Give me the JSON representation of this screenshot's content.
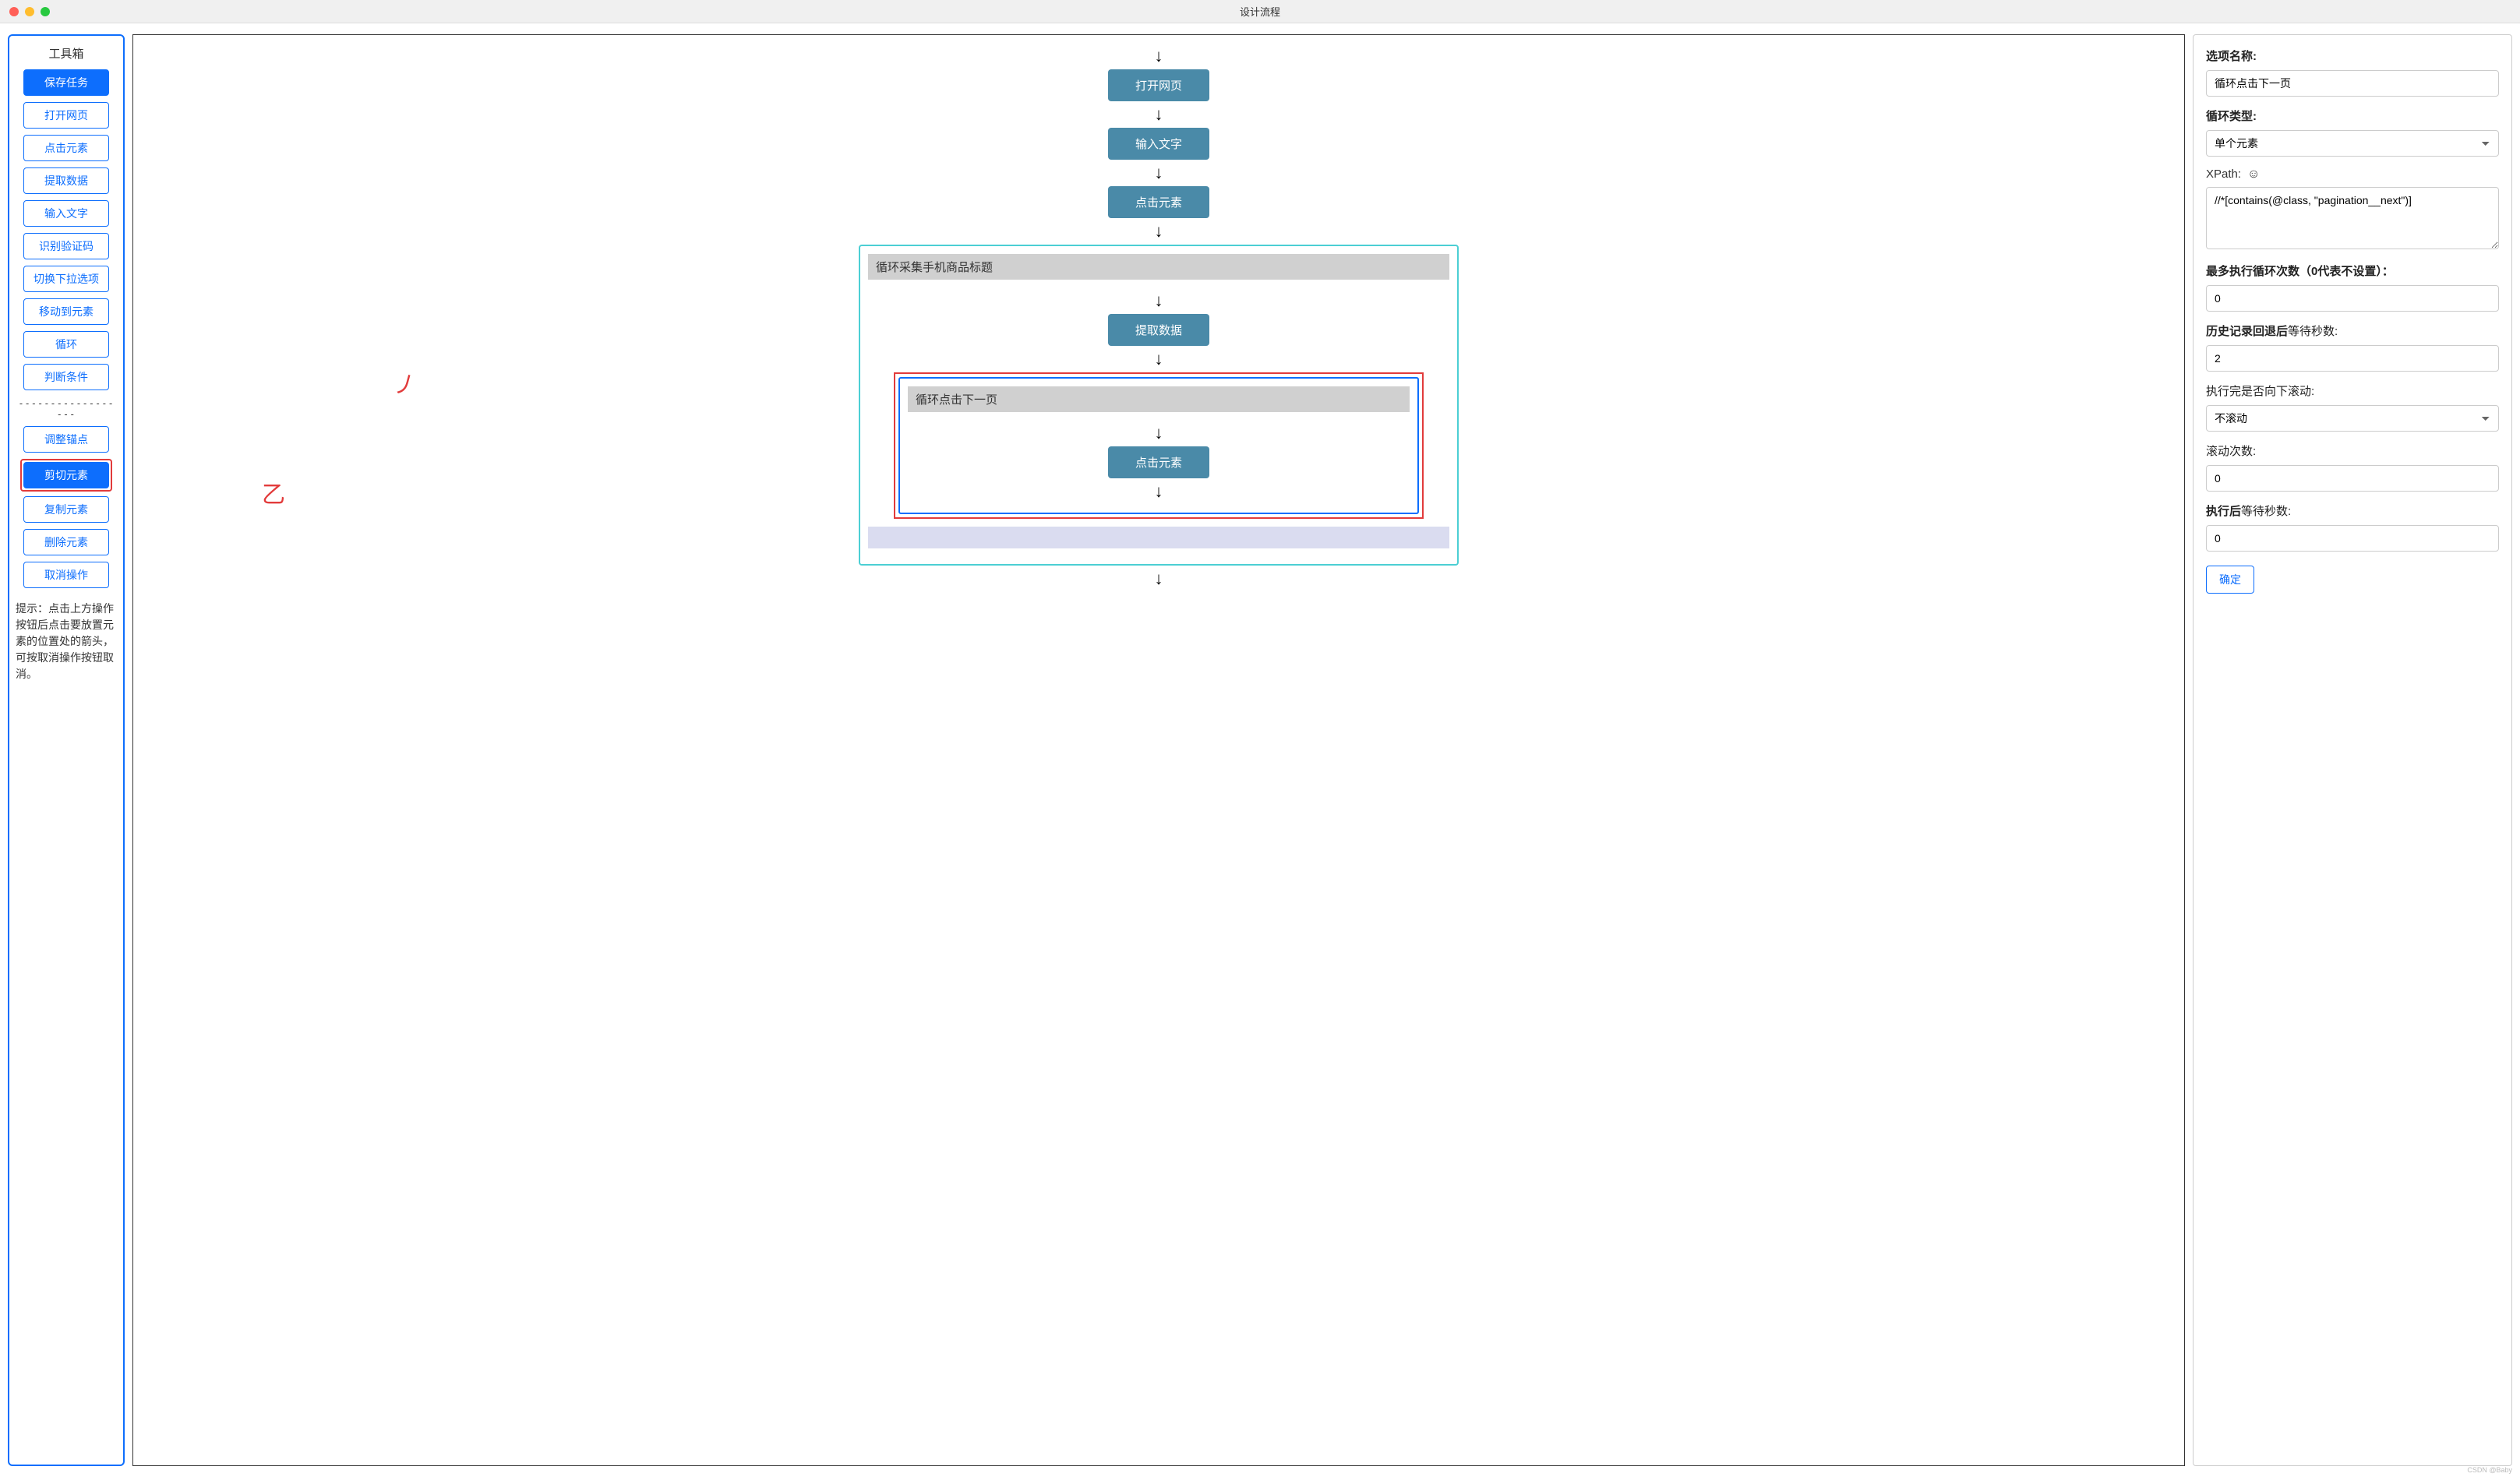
{
  "window": {
    "title": "设计流程"
  },
  "toolbox": {
    "title": "工具箱",
    "buttons_primary": [
      {
        "label": "保存任务",
        "active": true
      },
      {
        "label": "打开网页",
        "active": false
      },
      {
        "label": "点击元素",
        "active": false
      },
      {
        "label": "提取数据",
        "active": false
      },
      {
        "label": "输入文字",
        "active": false
      },
      {
        "label": "识别验证码",
        "active": false
      },
      {
        "label": "切换下拉选项",
        "active": false
      },
      {
        "label": "移动到元素",
        "active": false
      },
      {
        "label": "循环",
        "active": false
      },
      {
        "label": "判断条件",
        "active": false
      }
    ],
    "divider": "------------------",
    "buttons_secondary": [
      {
        "label": "调整锚点",
        "active": false,
        "highlight": false
      },
      {
        "label": "剪切元素",
        "active": true,
        "highlight": true
      },
      {
        "label": "复制元素",
        "active": false,
        "highlight": false
      },
      {
        "label": "删除元素",
        "active": false,
        "highlight": false
      },
      {
        "label": "取消操作",
        "active": false,
        "highlight": false
      }
    ],
    "hint": "提示：点击上方操作按钮后点击要放置元素的位置处的箭头，可按取消操作按钮取消。"
  },
  "flow": {
    "nodes": [
      "打开网页",
      "输入文字",
      "点击元素"
    ],
    "outer_loop": {
      "title": "循环采集手机商品标题",
      "node": "提取数据",
      "inner_loop": {
        "title": "循环点击下一页",
        "node": "点击元素"
      }
    }
  },
  "props": {
    "option_name_label": "选项名称:",
    "option_name_value": "循环点击下一页",
    "loop_type_label": "循环类型:",
    "loop_type_value": "单个元素",
    "xpath_label": "XPath:",
    "xpath_value": "//*[contains(@class, \"pagination__next\")]",
    "max_loop_label": "最多执行循环次数（0代表不设置）：",
    "max_loop_value": "0",
    "history_wait_label_bold": "历史记录回退后",
    "history_wait_label_rest": "等待秒数:",
    "history_wait_value": "2",
    "scroll_after_label": "执行完是否向下滚动:",
    "scroll_after_value": "不滚动",
    "scroll_count_label": "滚动次数:",
    "scroll_count_value": "0",
    "exec_wait_label_bold": "执行后",
    "exec_wait_label_rest": "等待秒数:",
    "exec_wait_value": "0",
    "confirm": "确定"
  },
  "annotations": {
    "mark1": "丿",
    "mark2": "乙"
  }
}
